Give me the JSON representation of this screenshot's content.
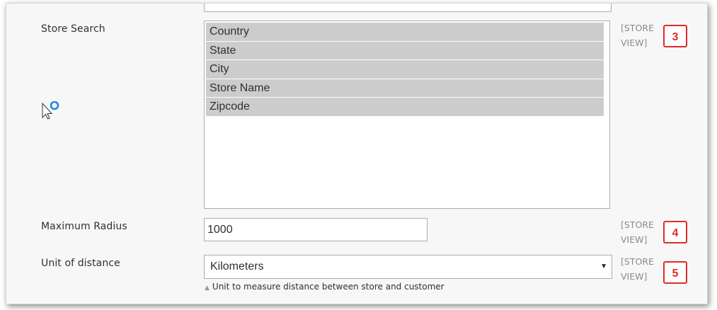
{
  "store_search": {
    "label": "Store Search",
    "options": [
      "Country",
      "State",
      "City",
      "Store Name",
      "Zipcode"
    ],
    "scope_line1": "[STORE",
    "scope_line2": "VIEW]",
    "badge": "3"
  },
  "max_radius": {
    "label": "Maximum Radius",
    "value": "1000",
    "scope_line1": "[STORE",
    "scope_line2": "VIEW]",
    "badge": "4"
  },
  "unit_distance": {
    "label": "Unit of distance",
    "selected": "Kilometers",
    "note": "Unit to measure distance between store and customer",
    "scope_line1": "[STORE",
    "scope_line2": "VIEW]",
    "badge": "5"
  },
  "colors": {
    "badge_red": "#e02b2b",
    "option_bg": "#cccccc",
    "busy_cursor": "#1e88e5"
  },
  "icons": {
    "cursor": "busy-cursor-icon",
    "dropdown": "caret-down-icon",
    "note": "triangle-up-icon"
  }
}
